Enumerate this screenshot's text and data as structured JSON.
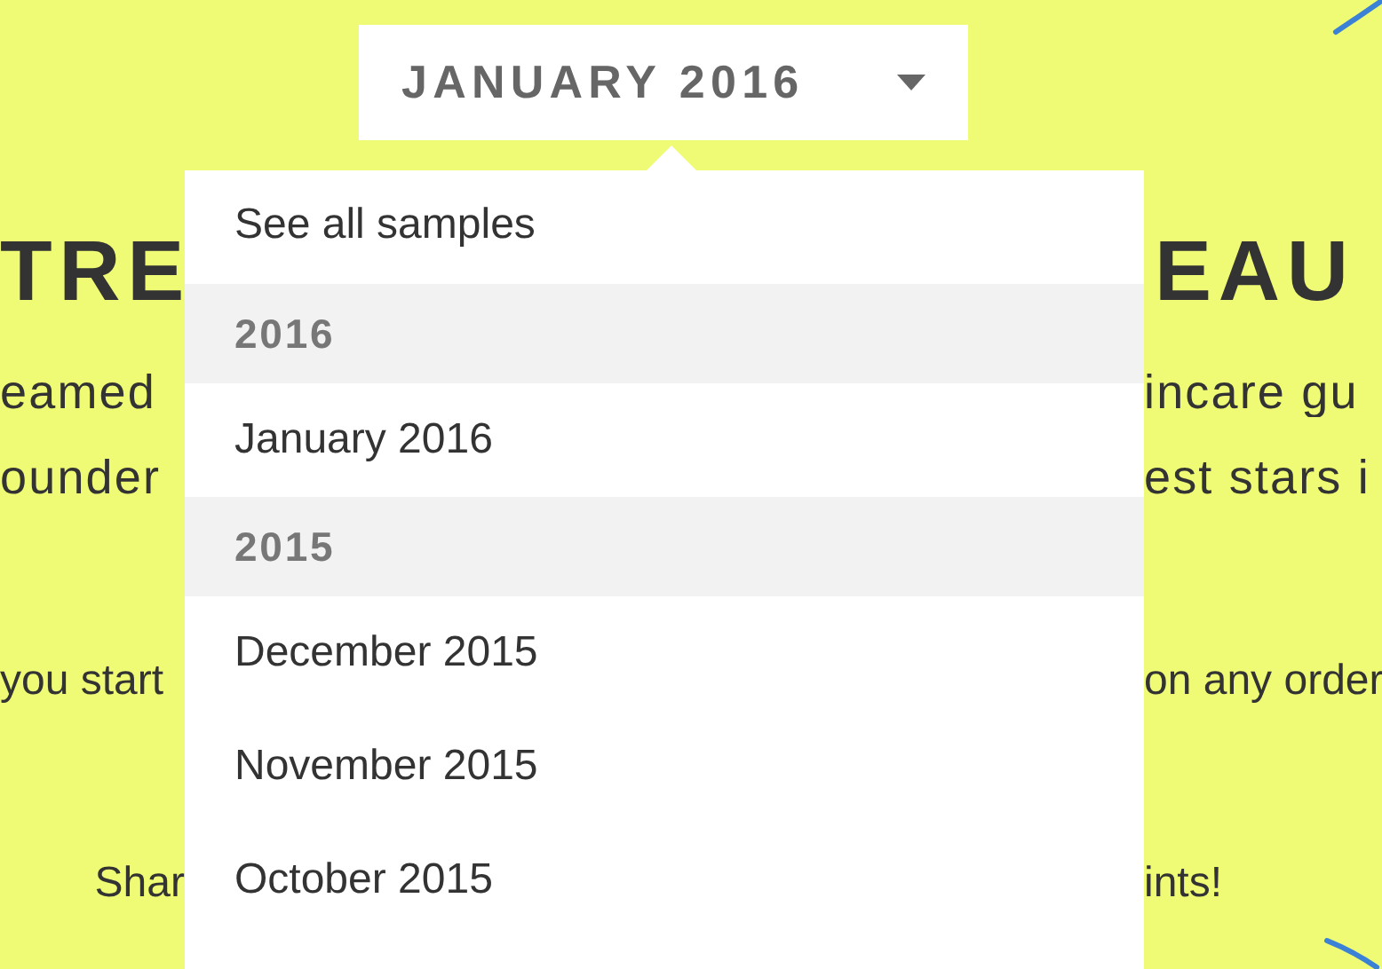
{
  "month_button": {
    "label": "JANUARY 2016",
    "expanded": true
  },
  "background_lines": [
    {
      "kind": "heading",
      "left": "TRE",
      "right": "EAU"
    },
    {
      "kind": "text",
      "left": "eamed",
      "right": "incare gu"
    },
    {
      "kind": "text",
      "left": "ounder",
      "right": "est stars i"
    },
    {
      "kind": "small",
      "left": "you start",
      "right": "on any order"
    },
    {
      "kind": "small",
      "left": "Shar",
      "right": "ints!"
    }
  ],
  "menu": [
    {
      "kind": "option",
      "label": "See all samples"
    },
    {
      "kind": "header",
      "label": "2016"
    },
    {
      "kind": "option",
      "label": "January 2016"
    },
    {
      "kind": "header",
      "label": "2015"
    },
    {
      "kind": "option",
      "label": "December 2015"
    },
    {
      "kind": "option",
      "label": "November 2015"
    },
    {
      "kind": "option",
      "label": "October 2015"
    }
  ]
}
